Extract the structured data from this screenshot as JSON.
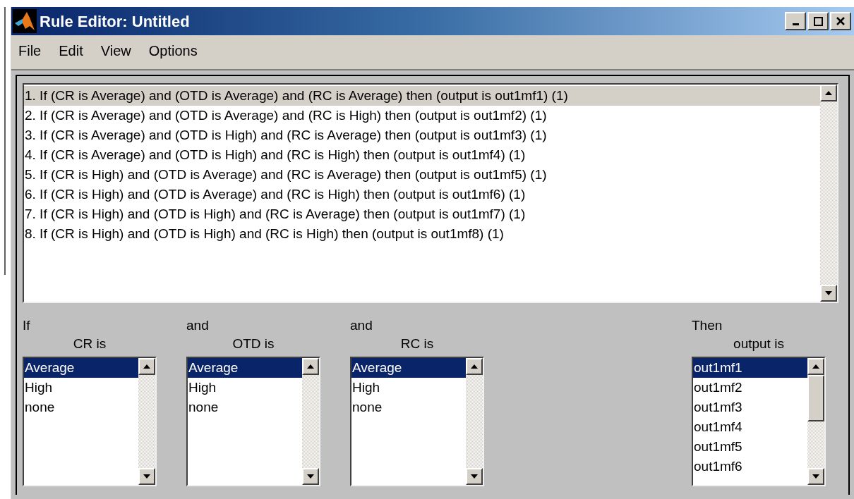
{
  "window": {
    "title": "Rule Editor: Untitled"
  },
  "menu": [
    "File",
    "Edit",
    "View",
    "Options"
  ],
  "rules": [
    {
      "text": "1. If (CR is Average) and (OTD is Average) and (RC is Average) then (output is out1mf1) (1)",
      "selected": true
    },
    {
      "text": "2. If (CR is Average) and (OTD is Average) and (RC is High) then (output is out1mf2) (1)",
      "selected": false
    },
    {
      "text": "3. If (CR is Average) and (OTD is High) and (RC is Average) then (output is out1mf3) (1)",
      "selected": false
    },
    {
      "text": "4. If (CR is Average) and (OTD is High) and (RC is High) then (output is out1mf4) (1)",
      "selected": false
    },
    {
      "text": "5. If (CR is High) and (OTD is Average) and (RC is Average) then (output is out1mf5) (1)",
      "selected": false
    },
    {
      "text": "6. If (CR is High) and (OTD is Average) and (RC is High) then (output is out1mf6) (1)",
      "selected": false
    },
    {
      "text": "7. If (CR is High) and (OTD is High) and (RC is Average) then (output is out1mf7) (1)",
      "selected": false
    },
    {
      "text": "8. If (CR is High) and (OTD is High) and (RC is High) then (output is out1mf8) (1)",
      "selected": false
    }
  ],
  "inputs": [
    {
      "connector": "If",
      "label": "CR is",
      "options": [
        {
          "label": "Average",
          "selected": true
        },
        {
          "label": "High",
          "selected": false
        },
        {
          "label": "none",
          "selected": false
        }
      ]
    },
    {
      "connector": "and",
      "label": "OTD is",
      "options": [
        {
          "label": "Average",
          "selected": true
        },
        {
          "label": "High",
          "selected": false
        },
        {
          "label": "none",
          "selected": false
        }
      ]
    },
    {
      "connector": "and",
      "label": "RC is",
      "options": [
        {
          "label": "Average",
          "selected": true
        },
        {
          "label": "High",
          "selected": false
        },
        {
          "label": "none",
          "selected": false
        }
      ]
    }
  ],
  "output": {
    "connector": "Then",
    "label": "output is",
    "options": [
      {
        "label": "out1mf1",
        "selected": true
      },
      {
        "label": "out1mf2",
        "selected": false
      },
      {
        "label": "out1mf3",
        "selected": false
      },
      {
        "label": "out1mf4",
        "selected": false
      },
      {
        "label": "out1mf5",
        "selected": false
      },
      {
        "label": "out1mf6",
        "selected": false
      }
    ]
  }
}
